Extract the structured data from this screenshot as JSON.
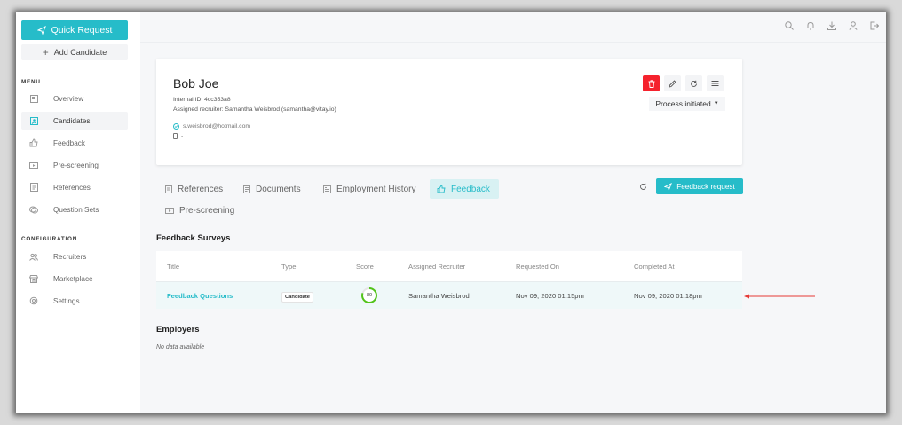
{
  "sidebar": {
    "quick_request": "Quick Request",
    "add_candidate": "Add Candidate",
    "menu_label": "MENU",
    "menu_items": [
      {
        "label": "Overview",
        "icon": "overview-icon"
      },
      {
        "label": "Candidates",
        "icon": "candidates-icon",
        "active": true
      },
      {
        "label": "Feedback",
        "icon": "thumbs-up-icon"
      },
      {
        "label": "Pre-screening",
        "icon": "video-icon"
      },
      {
        "label": "References",
        "icon": "reference-icon"
      },
      {
        "label": "Question Sets",
        "icon": "question-sets-icon"
      }
    ],
    "config_label": "CONFIGURATION",
    "config_items": [
      {
        "label": "Recruiters",
        "icon": "users-icon"
      },
      {
        "label": "Marketplace",
        "icon": "store-icon"
      },
      {
        "label": "Settings",
        "icon": "gear-icon"
      }
    ]
  },
  "topbar": {
    "icons": [
      "search-icon",
      "bell-icon",
      "download-icon",
      "user-icon",
      "logout-icon"
    ]
  },
  "candidate": {
    "name": "Bob Joe",
    "internal_id": "Internal ID: 4cc353a8",
    "recruiter": "Assigned recruiter: Samantha Weisbrod (samantha@vitay.io)",
    "email": "s.weisbrod@hotmail.com",
    "phone": "-",
    "status": "Process initiated"
  },
  "tabs": [
    {
      "label": "References",
      "icon": "reference-icon"
    },
    {
      "label": "Documents",
      "icon": "document-icon"
    },
    {
      "label": "Employment History",
      "icon": "briefcase-icon"
    },
    {
      "label": "Feedback",
      "icon": "thumbs-up-icon",
      "active": true
    },
    {
      "label": "Pre-screening",
      "icon": "video-icon"
    }
  ],
  "feedback_request": "Feedback request",
  "feedback_surveys": {
    "heading": "Feedback Surveys",
    "columns": [
      "Title",
      "Type",
      "Score",
      "Assigned Recruiter",
      "Requested On",
      "Completed At"
    ],
    "rows": [
      {
        "title": "Feedback Questions",
        "type": "Candidate",
        "score": "80",
        "score_fraction": 0.8,
        "recruiter": "Samantha Weisbrod",
        "requested_on": "Nov 09, 2020 01:15pm",
        "completed_at": "Nov 09, 2020 01:18pm"
      }
    ]
  },
  "employers": {
    "heading": "Employers",
    "empty": "No data available"
  },
  "colors": {
    "accent": "#26bcc9",
    "danger": "#f5222d",
    "score_ring": "#52c41a",
    "arrow": "#e53935"
  }
}
